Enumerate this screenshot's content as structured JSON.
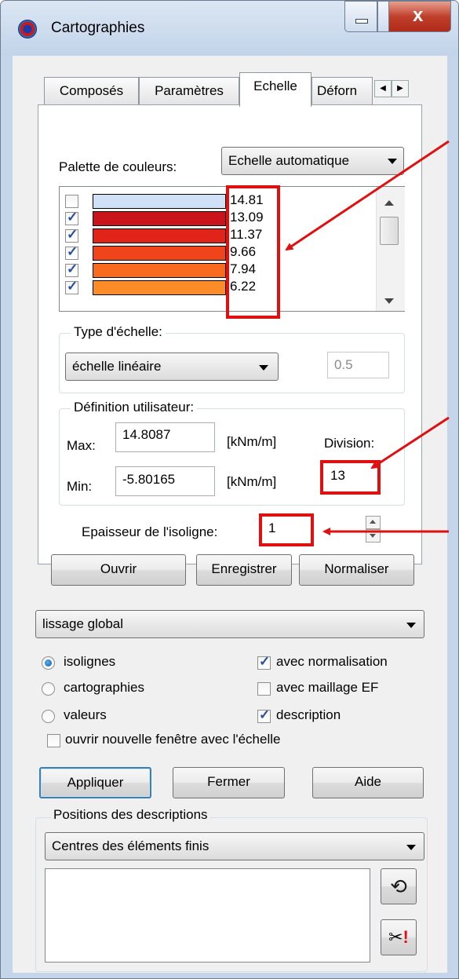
{
  "window": {
    "title": "Cartographies",
    "icon": "cartography-app-icon"
  },
  "tabs": [
    {
      "label": "Composés",
      "active": false
    },
    {
      "label": "Paramètres",
      "active": false
    },
    {
      "label": "Echelle",
      "active": true
    },
    {
      "label": "Déforn",
      "active": false
    }
  ],
  "palette": {
    "label": "Palette de couleurs:",
    "selected": "Echelle automatique"
  },
  "scale_rows": [
    {
      "value": "14.81",
      "checked": false,
      "color": "#cfe0f7"
    },
    {
      "value": "13.09",
      "checked": true,
      "color": "#c8141a"
    },
    {
      "value": "11.37",
      "checked": true,
      "color": "#e0241a"
    },
    {
      "value": "9.66",
      "checked": true,
      "color": "#f0441a"
    },
    {
      "value": "7.94",
      "checked": true,
      "color": "#f86a1e"
    },
    {
      "value": "6.22",
      "checked": true,
      "color": "#fb8c28"
    }
  ],
  "scale_type": {
    "label": "Type d'échelle:",
    "selected": "échelle linéaire",
    "value": "0.5"
  },
  "user_def": {
    "label": "Définition utilisateur:",
    "max_label": "Max:",
    "max_value": "14.8087",
    "max_unit": "[kNm/m]",
    "min_label": "Min:",
    "min_value": "-5.80165",
    "min_unit": "[kNm/m]",
    "division_label": "Division:",
    "division_value": "13"
  },
  "isoline": {
    "label": "Epaisseur de l'isoligne:",
    "value": "1"
  },
  "buttons": {
    "open": "Ouvrir",
    "save": "Enregistrer",
    "normalize": "Normaliser",
    "apply": "Appliquer",
    "close": "Fermer",
    "help": "Aide"
  },
  "smoothing": {
    "selected": "lissage global"
  },
  "options": {
    "isolines": "isolignes",
    "maps": "cartographies",
    "values": "valeurs",
    "with_norm": "avec normalisation",
    "with_mesh": "avec maillage EF",
    "description": "description",
    "new_window": "ouvrir nouvelle fenêtre avec l'échelle"
  },
  "positions": {
    "label": "Positions des descriptions",
    "selected": "Centres des éléments finis"
  },
  "colors": {
    "accent_red": "#e01010",
    "titlebar": "#c5d6ea"
  }
}
